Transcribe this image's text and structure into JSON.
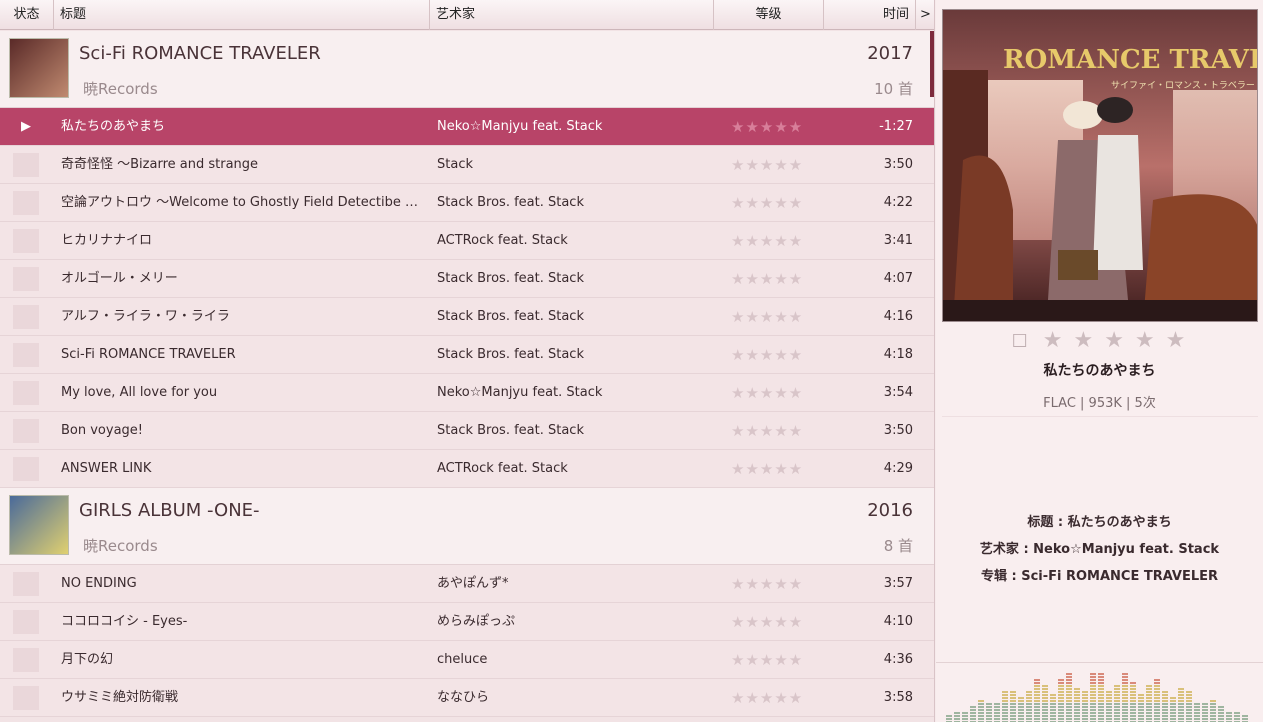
{
  "header": {
    "status": "状态",
    "title": "标题",
    "artist": "艺术家",
    "rating": "等级",
    "time": "时间",
    "more": ">"
  },
  "albums": [
    {
      "title": "Sci-Fi ROMANCE TRAVELER",
      "artist": "暁Records",
      "year": "2017",
      "count": "10 首",
      "tracks": [
        {
          "title": "私たちのあやまち",
          "artist": "Neko☆Manjyu feat. Stack",
          "time": "-1:27",
          "playing": true
        },
        {
          "title": "奇奇怪怪 ～Bizarre and strange",
          "artist": "Stack",
          "time": "3:50"
        },
        {
          "title": "空論アウトロウ ～Welcome to Ghostly Field Detectibe Offi...",
          "artist": "Stack Bros. feat. Stack",
          "time": "4:22"
        },
        {
          "title": "ヒカリナナイロ",
          "artist": "ACTRock feat. Stack",
          "time": "3:41"
        },
        {
          "title": "オルゴール・メリー",
          "artist": "Stack Bros. feat. Stack",
          "time": "4:07"
        },
        {
          "title": "アルフ・ライラ・ワ・ライラ",
          "artist": "Stack Bros. feat. Stack",
          "time": "4:16"
        },
        {
          "title": "Sci-Fi ROMANCE TRAVELER",
          "artist": "Stack Bros. feat. Stack",
          "time": "4:18"
        },
        {
          "title": "My love, All love for you",
          "artist": "Neko☆Manjyu feat. Stack",
          "time": "3:54"
        },
        {
          "title": "Bon voyage!",
          "artist": "Stack Bros. feat. Stack",
          "time": "3:50"
        },
        {
          "title": "ANSWER LINK",
          "artist": "ACTRock feat. Stack",
          "time": "4:29"
        }
      ]
    },
    {
      "title": "GIRLS ALBUM -ONE-",
      "artist": "暁Records",
      "year": "2016",
      "count": "8 首",
      "tracks": [
        {
          "title": "NO ENDING",
          "artist": "あやぽんず*",
          "time": "3:57"
        },
        {
          "title": "ココロコイシ - Eyes-",
          "artist": "めらみぽっぷ",
          "time": "4:10"
        },
        {
          "title": "月下の幻",
          "artist": "cheluce",
          "time": "4:36"
        },
        {
          "title": "ウサミミ絶対防衛戦",
          "artist": "ななひら",
          "time": "3:58"
        }
      ]
    }
  ],
  "now_playing": {
    "cover_text": "ROMANCE TRAVELER",
    "cover_subtext": "サイファイ・ロマンス・トラベラー",
    "title": "私たちのあやまち",
    "meta": "FLAC  | 953K | 5次",
    "info_title": "标题 : 私たちのあやまち",
    "info_artist": "艺术家 : Neko☆Manjyu feat. Stack",
    "info_album": "专辑 : Sci-Fi ROMANCE TRAVELER"
  },
  "glyphs": {
    "play": "▶",
    "stars": "★★★★★",
    "bookmark": "☐",
    "rating_stars": "★ ★ ★ ★ ★"
  },
  "colors": {
    "accent": "#b84468",
    "album_accent": "#7e2a3c"
  }
}
